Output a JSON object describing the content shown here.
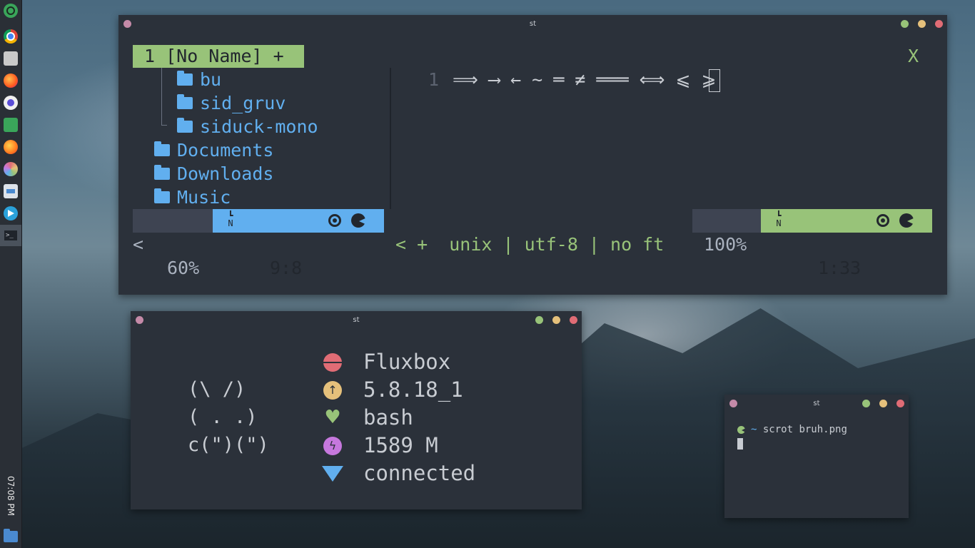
{
  "dock": {
    "clock": "07:08 PM",
    "apps": [
      "app-icon",
      "chrome-icon",
      "files-icon",
      "firefox-icon",
      "browser-icon",
      "image-viewer-icon",
      "firefox-dev-icon",
      "color-picker-icon",
      "installer-icon",
      "telegram-icon",
      "terminal-icon"
    ]
  },
  "vim_window": {
    "title": "st",
    "tab_label": "1 [No Name] +",
    "close_tab": "X",
    "tree": {
      "nested": [
        "bu",
        "sid_gruv",
        "siduck-mono"
      ],
      "top": [
        "Documents",
        "Downloads",
        "Music"
      ]
    },
    "line_number": "1",
    "ligatures": "⟹ ⟶ ← ~ ═ ≠ ═══ ⟺ ⩽ ⩾",
    "statusline": {
      "left_arrow": "<",
      "left_percent": "60%",
      "left_pos": "9:8",
      "mid": "< +  unix | utf-8 | no ft",
      "right_percent": "100%",
      "right_pos": "1:33"
    }
  },
  "fetch_window": {
    "title": "st",
    "ascii": [
      "(\\ /)",
      "( . .)",
      "c(\")(\")"
    ],
    "info": [
      {
        "icon": "os-icon",
        "value": "Fluxbox",
        "color": "#e06c75"
      },
      {
        "icon": "kernel-icon",
        "value": "5.8.18_1",
        "color": "#e5c07b"
      },
      {
        "icon": "shell-icon",
        "value": "bash",
        "color": "#98c379"
      },
      {
        "icon": "memory-icon",
        "value": "1589 M",
        "color": "#c678dd"
      },
      {
        "icon": "wifi-icon",
        "value": "connected",
        "color": "#61afef"
      }
    ]
  },
  "small_terminal": {
    "title": "st",
    "prompt_dir": "~",
    "command": "scrot bruh.png"
  },
  "colors": {
    "green": "#98c379",
    "blue": "#61afef",
    "bg": "#2b313a"
  }
}
